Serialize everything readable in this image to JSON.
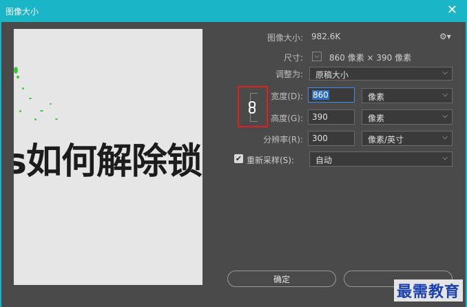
{
  "window": {
    "title": "图像大小",
    "close_glyph": "✕"
  },
  "preview": {
    "text": "s如何解除锁"
  },
  "image_size": {
    "label": "图像大小:",
    "value": "982.6K",
    "gear_glyph": "⚙▾"
  },
  "dimensions": {
    "label": "尺寸:",
    "value": "860 像素 × 390 像素"
  },
  "fit_to": {
    "label": "调整为:",
    "value": "原稿大小"
  },
  "width": {
    "label": "宽度(D):",
    "value": "860",
    "unit": "像素"
  },
  "height": {
    "label": "高度(G):",
    "value": "390",
    "unit": "像素"
  },
  "resolution": {
    "label": "分辨率(R):",
    "value": "300",
    "unit": "像素/英寸"
  },
  "resample": {
    "label": "重新采样(S):",
    "checked": true,
    "value": "自动"
  },
  "buttons": {
    "ok": "确定",
    "cancel": ""
  },
  "watermark": "最需教育",
  "colors": {
    "title_bar": "#1ab5c7",
    "highlight_box": "#e02020",
    "selection": "#2f6fcc"
  }
}
